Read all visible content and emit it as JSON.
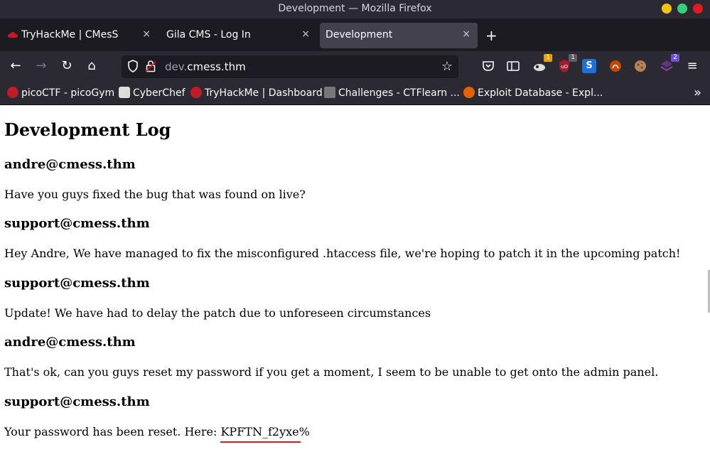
{
  "window": {
    "title": "Development — Mozilla Firefox"
  },
  "tabs": [
    {
      "label": "TryHackMe | CMesS",
      "close": "×"
    },
    {
      "label": "Gila CMS - Log In",
      "close": "×"
    },
    {
      "label": "Development",
      "close": "×"
    }
  ],
  "new_tab": "+",
  "nav": {
    "back": "←",
    "forward": "→",
    "reload": "↻",
    "home": "⌂",
    "url_host_dim": "dev.",
    "url_host": "cmess.thm",
    "bookmark_star": "☆",
    "menu": "≡"
  },
  "extensions": [
    {
      "name": "extension-1",
      "badge": "1",
      "badge_color": "#e5a50a"
    },
    {
      "name": "ublock-origin",
      "badge": "1",
      "badge_color": "#5e5c64"
    },
    {
      "name": "extension-s",
      "label": "S"
    },
    {
      "name": "extension-4"
    },
    {
      "name": "cookie-editor"
    },
    {
      "name": "extension-6",
      "badge": "2",
      "badge_color": "#6f4fd6"
    }
  ],
  "bookmarks": [
    {
      "label": "picoCTF - picoGym",
      "icon": "picoctf-icon",
      "color": "#c01c28"
    },
    {
      "label": "CyberChef",
      "icon": "cyberchef-icon",
      "color": "#deddda"
    },
    {
      "label": "TryHackMe | Dashboard",
      "icon": "tryhackme-icon",
      "color": "#c01c28"
    },
    {
      "label": "Challenges - CTFlearn ...",
      "icon": "ctflearn-icon",
      "color": "#77767b"
    },
    {
      "label": "Exploit Database - Expl...",
      "icon": "exploitdb-icon",
      "color": "#e66100"
    }
  ],
  "bookmarks_more": "»",
  "page": {
    "heading": "Development Log",
    "entries": [
      {
        "author": "andre@cmess.thm",
        "message": "Have you guys fixed the bug that was found on live?"
      },
      {
        "author": "support@cmess.thm",
        "message": "Hey Andre, We have managed to fix the misconfigured .htaccess file, we're hoping to patch it in the upcoming patch!"
      },
      {
        "author": "support@cmess.thm",
        "message": "Update! We have had to delay the patch due to unforeseen circumstances"
      },
      {
        "author": "andre@cmess.thm",
        "message": "That's ok, can you guys reset my password if you get a moment, I seem to be unable to get onto the admin panel."
      },
      {
        "author": "support@cmess.thm",
        "message": "Your password has been reset. Here: KPFTN_f2yxe%"
      }
    ]
  }
}
